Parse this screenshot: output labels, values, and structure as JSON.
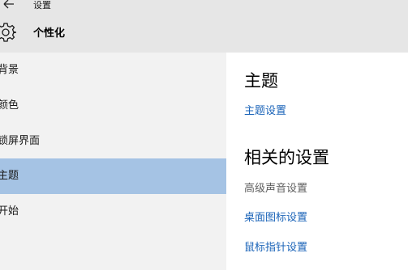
{
  "window": {
    "title": "设置",
    "back_icon": "back-arrow-icon"
  },
  "header": {
    "icon": "gear-icon",
    "title": "个性化"
  },
  "sidebar": {
    "items": [
      {
        "label": "背景",
        "selected": false
      },
      {
        "label": "颜色",
        "selected": false
      },
      {
        "label": "锁屏界面",
        "selected": false
      },
      {
        "label": "主题",
        "selected": true
      },
      {
        "label": "开始",
        "selected": false
      }
    ]
  },
  "content": {
    "section_theme": {
      "heading": "主题",
      "link": "主题设置"
    },
    "section_related": {
      "heading": "相关的设置",
      "items": [
        {
          "label": "高级声音设置",
          "type": "text"
        },
        {
          "label": "桌面图标设置",
          "type": "link"
        },
        {
          "label": "鼠标指针设置",
          "type": "link"
        }
      ]
    }
  },
  "colors": {
    "selected_bg": "#a5c3e4",
    "link": "#1a63b8",
    "header_bg": "#e6e6e6",
    "sidebar_bg": "#f2f2f2"
  }
}
